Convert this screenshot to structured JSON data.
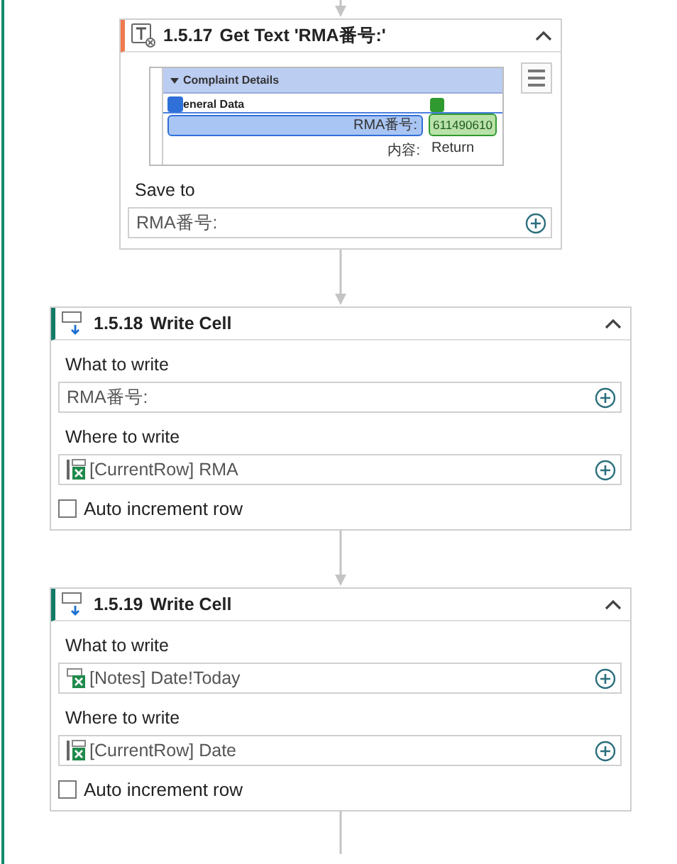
{
  "steps": [
    {
      "kind": "get_text",
      "number": "1.5.17",
      "title": "Get Text 'RMA番号:'",
      "expanded": true,
      "preview": {
        "section": "Complaint Details",
        "group": "eneral Data",
        "anchor_label": "RMA番号:",
        "target_value": "611490610",
        "rows": [
          {
            "label": "内容:",
            "value": "Return"
          }
        ]
      },
      "fields": [
        {
          "label": "Save to",
          "kind": "text",
          "value": "RMA番号:"
        }
      ]
    },
    {
      "kind": "write_cell",
      "number": "1.5.18",
      "title": "Write Cell",
      "expanded": true,
      "fields": [
        {
          "label": "What to write",
          "kind": "text",
          "value": "RMA番号:"
        },
        {
          "label": "Where to write",
          "kind": "excel_range",
          "value": "[CurrentRow] RMA"
        }
      ],
      "auto_increment": {
        "label": "Auto increment row",
        "checked": false
      }
    },
    {
      "kind": "write_cell",
      "number": "1.5.19",
      "title": "Write Cell",
      "expanded": true,
      "fields": [
        {
          "label": "What to write",
          "kind": "excel_variable",
          "value": "[Notes] Date!Today"
        },
        {
          "label": "Where to write",
          "kind": "excel_range",
          "value": "[CurrentRow] Date"
        }
      ],
      "auto_increment": {
        "label": "Auto increment row",
        "checked": false
      }
    }
  ]
}
